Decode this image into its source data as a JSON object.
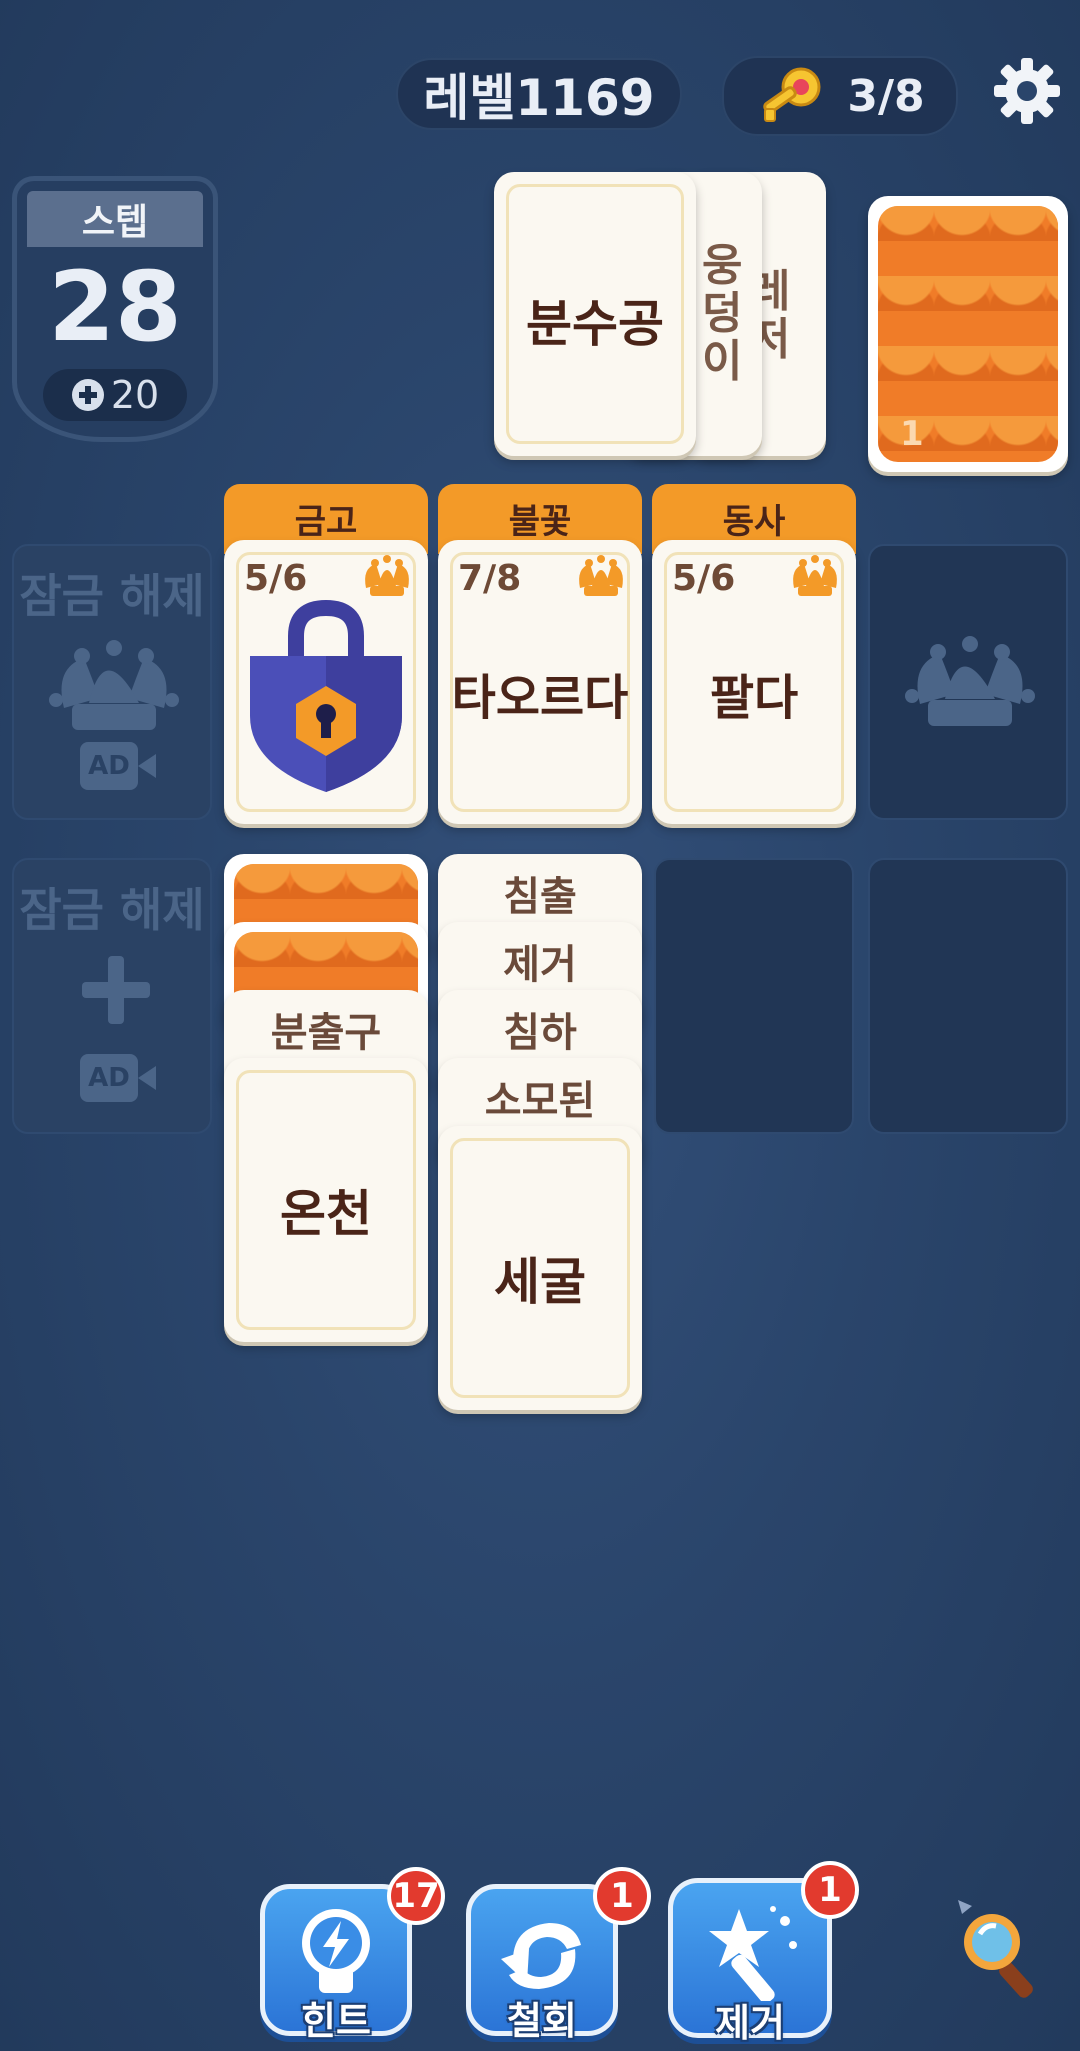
{
  "top_bar": {
    "level_label": "레벨1169",
    "keys": "3/8"
  },
  "step": {
    "title": "스텝",
    "count": "28",
    "bonus": "20"
  },
  "stock_pile": {
    "top_word": "분수공",
    "second_word": "웅덩이",
    "third_word": "레저"
  },
  "deck": {
    "remaining": "1"
  },
  "foundations": [
    {
      "category": "금고",
      "progress": "5/6",
      "locked": true
    },
    {
      "category": "불꽃",
      "progress": "7/8",
      "word": "타오르다"
    },
    {
      "category": "동사",
      "progress": "5/6",
      "word": "팔다"
    }
  ],
  "unlock_slots": {
    "label": "잠금 해제",
    "ad": "AD"
  },
  "tableau": {
    "col1": {
      "peek": [
        "분출구"
      ],
      "top": "온천"
    },
    "col2": {
      "peek": [
        "침출",
        "제거",
        "침하",
        "소모된"
      ],
      "top": "세굴"
    }
  },
  "tools": [
    {
      "label": "힌트",
      "count": "17"
    },
    {
      "label": "철회",
      "count": "1"
    },
    {
      "label": "제거",
      "count": "1"
    }
  ],
  "colors": {
    "background": "#2a456b",
    "card": "#fbf8f1",
    "category_tab": "#f39a28",
    "card_back": "#f07c28",
    "button": "#3a8de6",
    "badge": "#e23a2e"
  }
}
